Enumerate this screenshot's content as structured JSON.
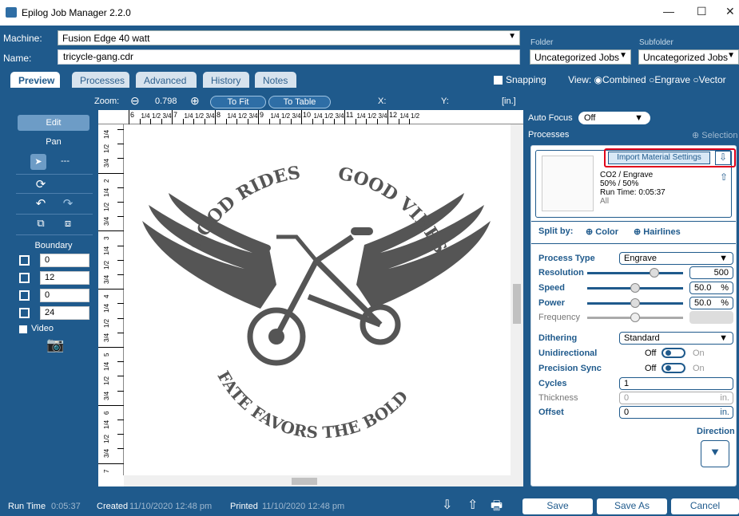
{
  "window": {
    "title": "Epilog Job Manager 2.2.0",
    "minimize": "—",
    "maximize": "☐",
    "close": "✕"
  },
  "header": {
    "machine_label": "Machine:",
    "machine_value": "Fusion Edge 40 watt",
    "name_label": "Name:",
    "name_value": "tricycle-gang.cdr",
    "folder_label": "Folder",
    "folder_value": "Uncategorized Jobs",
    "subfolder_label": "Subfolder",
    "subfolder_value": "Uncategorized Jobs"
  },
  "tabs": [
    "Preview",
    "Processes",
    "Advanced",
    "History",
    "Notes"
  ],
  "viewbar": {
    "snapping": "Snapping",
    "view_label": "View:",
    "combined": "Combined",
    "engrave": "Engrave",
    "vector": "Vector"
  },
  "zoom": {
    "label": "Zoom:",
    "value": "0.798",
    "to_fit": "To Fit",
    "to_table": "To Table",
    "x_label": "X:",
    "y_label": "Y:",
    "units": "[in.]"
  },
  "left": {
    "edit": "Edit",
    "pan": "Pan",
    "pan_value": "---",
    "boundary": "Boundary",
    "fields": [
      "0",
      "12",
      "0",
      "24"
    ],
    "video": "Video"
  },
  "ruler": {
    "top": [
      "6",
      "1/4",
      "1/2",
      "3/4",
      "7",
      "1/4",
      "1/2",
      "3/4",
      "8",
      "1/4",
      "1/2",
      "3/4",
      "9",
      "1/4",
      "1/2",
      "3/4",
      "10",
      "1/4",
      "1/2",
      "3/4",
      "11",
      "1/4",
      "1/2",
      "3/4",
      "12",
      "1/4",
      "1/2"
    ],
    "left": [
      "1/4",
      "1/2",
      "3/4",
      "2",
      "1/4",
      "1/2",
      "3/4",
      "3",
      "1/4",
      "1/2",
      "3/4",
      "4",
      "1/4",
      "1/2",
      "3/4",
      "5",
      "1/4",
      "1/2",
      "3/4",
      "6",
      "1/4",
      "1/2",
      "3/4",
      "7"
    ]
  },
  "artwork": {
    "top_left": "GOOD RIDES",
    "top_right": "GOOD VIBES",
    "bottom": "FATE FAVORS THE BOLD"
  },
  "right": {
    "auto_focus": "Auto Focus",
    "auto_focus_value": "Off",
    "processes": "Processes",
    "selection": "Selection",
    "import_btn": "Import Material Settings",
    "process_line1": "CO2 / Engrave",
    "process_line2": "50% / 50%",
    "process_line3": "Run Time: 0:05:37",
    "process_line4": "All",
    "split_by": "Split by:",
    "color": "Color",
    "hairlines": "Hairlines",
    "process_type_label": "Process Type",
    "process_type": "Engrave",
    "resolution_label": "Resolution",
    "resolution": "500",
    "speed_label": "Speed",
    "speed": "50.0",
    "speed_unit": "%",
    "power_label": "Power",
    "power": "50.0",
    "power_unit": "%",
    "frequency_label": "Frequency",
    "dithering_label": "Dithering",
    "dithering": "Standard",
    "unidirectional": "Unidirectional",
    "precision_sync": "Precision Sync",
    "off": "Off",
    "on": "On",
    "cycles_label": "Cycles",
    "cycles": "1",
    "thickness_label": "Thickness",
    "thickness": "0",
    "offset_label": "Offset",
    "offset": "0",
    "unit_in": "in.",
    "direction": "Direction"
  },
  "status": {
    "run_time_label": "Run Time",
    "run_time": "0:05:37",
    "created_label": "Created",
    "created": "11/10/2020 12:48 pm",
    "printed_label": "Printed",
    "printed": "11/10/2020 12:48 pm",
    "save": "Save",
    "save_as": "Save As",
    "cancel": "Cancel"
  },
  "colors": {
    "brand": "#1f5a8c",
    "highlight": "#e0001b",
    "art": "#555555"
  }
}
